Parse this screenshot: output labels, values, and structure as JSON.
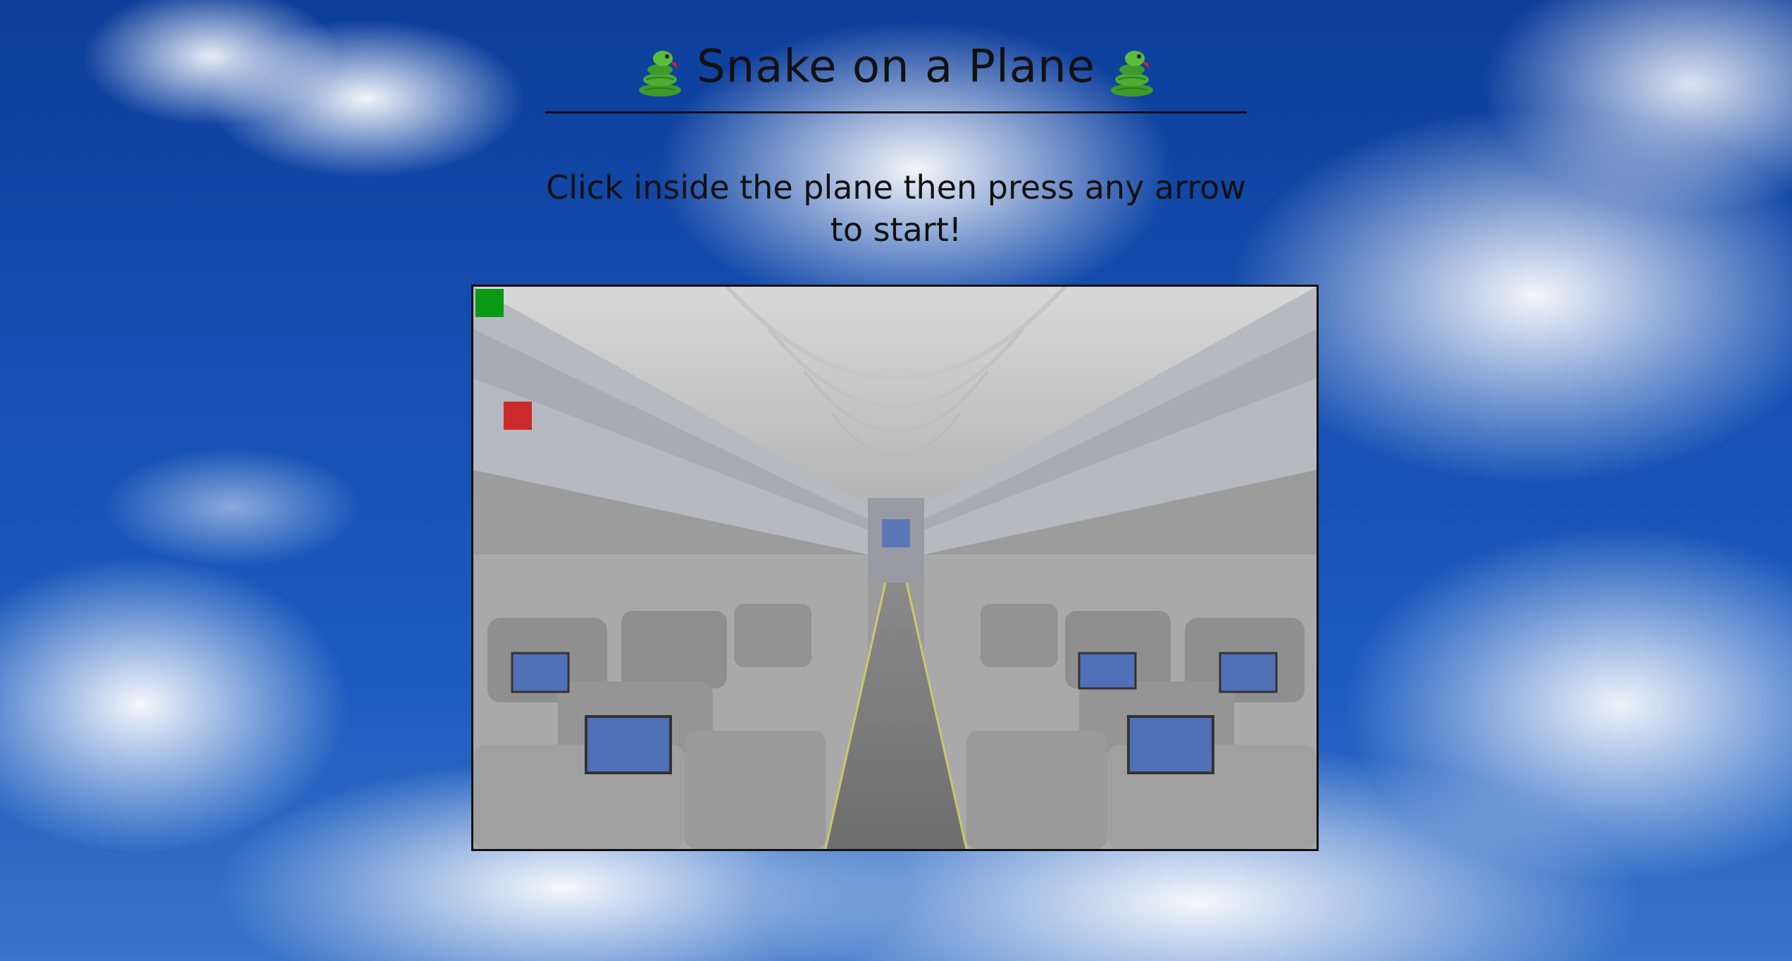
{
  "page": {
    "title": "Snake on a Plane",
    "instructions": "Click inside the plane then press any arrow to start!"
  },
  "game": {
    "snake_color": "#0a9a16",
    "food_color": "#cc2a2a",
    "border_color": "#111111",
    "icons": {
      "title_left": "snake-emoji-icon",
      "title_right": "snake-emoji-icon"
    }
  }
}
